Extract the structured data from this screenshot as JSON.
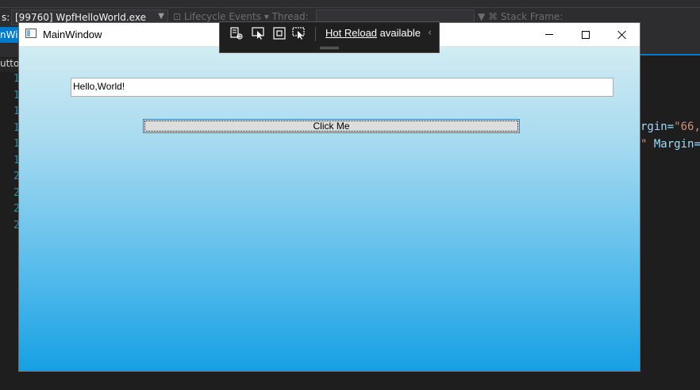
{
  "ide": {
    "process_label": "s:",
    "process_value": "[99760] WpfHelloWorld.exe",
    "lifecycle_label": "Lifecycle Events",
    "thread_label": "Thread:",
    "stack_frame_label": "Stack Frame:",
    "active_tab": "nWir",
    "sub_tab": "uttor",
    "gutter_lines": [
      "1",
      "1",
      "1",
      "1",
      "1",
      "1",
      "2",
      "2",
      "2",
      "2"
    ],
    "code_line_1": {
      "attr": "rgin=",
      "val": "\"66,"
    },
    "code_line_2": {
      "val": "\"",
      "attr": " Margin="
    }
  },
  "window": {
    "title": "MainWindow",
    "textbox_value": "Hello,World!",
    "button_label": "Click Me"
  },
  "hot_reload": {
    "link": "Hot Reload",
    "status": " available"
  },
  "colors": {
    "gradient_top": "#d2ecf2",
    "gradient_bottom": "#16a0e4",
    "ide_accent": "#007acc"
  }
}
